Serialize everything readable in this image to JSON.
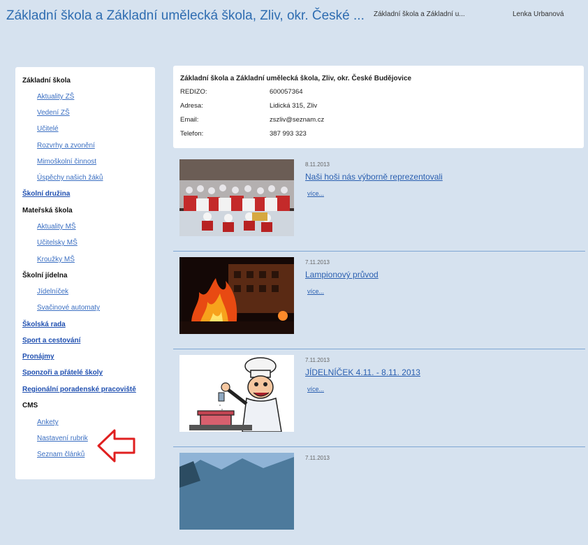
{
  "header": {
    "site_title": "Základní škola a Základní umělecká škola, Zliv, okr. České ...",
    "school_short": "Základní škola a Základní u...",
    "user_name": "Lenka Urbanová"
  },
  "sidebar": {
    "items": [
      {
        "label": "Základní škola",
        "kind": "head"
      },
      {
        "label": "Aktuality ZŠ",
        "kind": "sub"
      },
      {
        "label": "Vedení ZŠ",
        "kind": "sub"
      },
      {
        "label": "Učitelé",
        "kind": "sub"
      },
      {
        "label": "Rozvrhy a zvonění",
        "kind": "sub"
      },
      {
        "label": "Mimoškolní činnost",
        "kind": "sub"
      },
      {
        "label": "Úspěchy našich žáků",
        "kind": "sub"
      },
      {
        "label": "Školní družina",
        "kind": "link"
      },
      {
        "label": "Mateřská škola",
        "kind": "head"
      },
      {
        "label": "Aktuality MŠ",
        "kind": "sub"
      },
      {
        "label": "Učitelsky MŠ",
        "kind": "sub"
      },
      {
        "label": "Kroužky MŠ",
        "kind": "sub"
      },
      {
        "label": "Školní jídelna",
        "kind": "head"
      },
      {
        "label": "Jídelníček",
        "kind": "sub"
      },
      {
        "label": "Svačinové automaty",
        "kind": "sub"
      },
      {
        "label": "Školská rada",
        "kind": "link"
      },
      {
        "label": "Sport a cestování",
        "kind": "link"
      },
      {
        "label": "Pronájmy",
        "kind": "link"
      },
      {
        "label": "Sponzoři a přátelé školy",
        "kind": "link"
      },
      {
        "label": "Regionální poradenské pracoviště",
        "kind": "link"
      },
      {
        "label": "CMS",
        "kind": "head"
      },
      {
        "label": "Ankety",
        "kind": "sub"
      },
      {
        "label": "Nastavení rubrik",
        "kind": "sub"
      },
      {
        "label": "Seznam článků",
        "kind": "sub"
      }
    ]
  },
  "info": {
    "title": "Základní škola a Základní umělecká škola, Zliv, okr. České Budějovice",
    "rows": [
      {
        "label": "REDIZO:",
        "value": "600057364"
      },
      {
        "label": "Adresa:",
        "value": "Lidická 315, Zliv"
      },
      {
        "label": "Email:",
        "value": "zszliv@seznam.cz"
      },
      {
        "label": "Telefon:",
        "value": "387 993 323"
      }
    ]
  },
  "articles": [
    {
      "date": "8.11.2013",
      "title": "Naši hoši nás výborně reprezentovali",
      "more": "více...",
      "image": "hockey-team-photo"
    },
    {
      "date": "7.11.2013",
      "title": "Lampionový průvod",
      "more": "více...",
      "image": "burning-building-photo"
    },
    {
      "date": "7.11.2013",
      "title": "JÍDELNÍČEK 4.11. - 8.11. 2013",
      "more": "více...",
      "image": "chef-cartoon"
    },
    {
      "date": "7.11.2013",
      "title": "",
      "more": "",
      "image": "landscape-photo"
    }
  ],
  "annotation": {
    "icon": "red-arrow-icon",
    "color": "#e02020"
  }
}
